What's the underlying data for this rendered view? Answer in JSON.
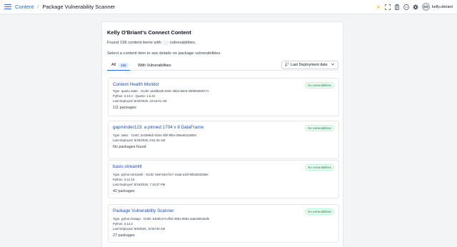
{
  "header": {
    "breadcrumb_root": "Content",
    "breadcrumb_sep": "/",
    "breadcrumb_current": "Package Vulnerability Scanner",
    "user_initials": "KO",
    "username": "kelly.obriant",
    "icons": [
      "menu-icon",
      "sun-icon",
      "expand-icon",
      "clipboard-icon",
      "more-icon",
      "gear-icon"
    ]
  },
  "main": {
    "title": "Kelly O'Briant's Connect Content",
    "summary_prefix": "Found 196 content items with",
    "summary_suffix": "vulnerabilities.",
    "instruction": "Select a content item to see details on package vulnerabilities.",
    "tabs": [
      {
        "label": "All",
        "count": "196"
      },
      {
        "label": "With Vulnerabilities"
      }
    ],
    "sort_label": "Last Deployment date",
    "sort_icon": "sort-icon"
  },
  "items": [
    {
      "title": "Content Health Monitor",
      "badge": "No vulnerabilities",
      "meta": [
        "Type: quarto-static · GUID: ae0db32b-630c-4bb4-b6e5-490992558771",
        "Python: 3.13.3 · Quarto: 1.6.43",
        "Last Deployed: 8/20/2025, 10:54:01 AM"
      ],
      "count": "111 packages"
    },
    {
      "title": "gapminder123: a pinned 1704 x 8 DataFrame",
      "badge": "No vulnerabilities",
      "meta": [
        "Type: static · GUID: 2e2096cb-d344-4f5f-8f54-308e6b228054",
        "Last Deployed: 8/20/2025, 9:51:45 AM"
      ],
      "count": "No packages found"
    },
    {
      "title": "basic-streamlit",
      "badge": "No vulnerabilities",
      "meta": [
        "Type: python-streamlit · GUID: 5e97c9a-f4c7-41a6-a10f-90b3d33539e",
        "Python: 3.12.10",
        "Last Deployed: 8/19/2025, 7:19:37 PM"
      ],
      "count": "42 packages"
    },
    {
      "title": "Package Vulnerability Scanner",
      "badge": "No vulnerabilities",
      "meta": [
        "Type: python-fastapi · GUID: 54b6b474-df16-49b1-98d1-4a6c56633afe",
        "Python: 3.13.3",
        "Last Deployed: 8/6/2025, 10:50:30 AM"
      ],
      "count": "27 packages"
    }
  ],
  "colors": {
    "accent": "#2563eb",
    "badge_text": "#15803d",
    "badge_bg": "#ecfdf5",
    "page_bg": "#f3f4f6"
  }
}
